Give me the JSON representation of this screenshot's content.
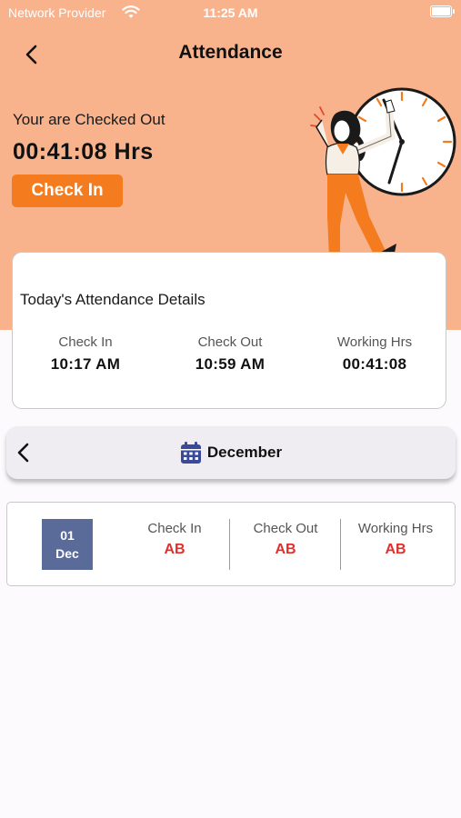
{
  "status_bar": {
    "carrier": "Network Provider",
    "time": "11:25 AM"
  },
  "header": {
    "title": "Attendance"
  },
  "hero": {
    "status_text": "Your are Checked Out",
    "elapsed": "00:41:08 Hrs",
    "check_in_label": "Check In"
  },
  "today": {
    "title": "Today's Attendance Details",
    "columns": [
      {
        "label": "Check In",
        "value": "10:17 AM"
      },
      {
        "label": "Check Out",
        "value": "10:59 AM"
      },
      {
        "label": "Working Hrs",
        "value": "00:41:08"
      }
    ]
  },
  "month_nav": {
    "month": "December"
  },
  "records": [
    {
      "day": "01",
      "month": "Dec",
      "columns": [
        {
          "label": "Check In",
          "value": "AB"
        },
        {
          "label": "Check Out",
          "value": "AB"
        },
        {
          "label": "Working Hrs",
          "value": "AB"
        }
      ]
    }
  ],
  "colors": {
    "hero_bg": "#f9b38c",
    "accent": "#f47b1e",
    "absent": "#e0302c",
    "date_badge": "#5a6a99",
    "calendar_icon": "#3a4a9a"
  },
  "icons": {
    "back": "chevron-left-icon",
    "prev_month": "chevron-left-icon",
    "calendar": "calendar-icon",
    "wifi": "wifi-icon",
    "battery": "battery-icon"
  }
}
